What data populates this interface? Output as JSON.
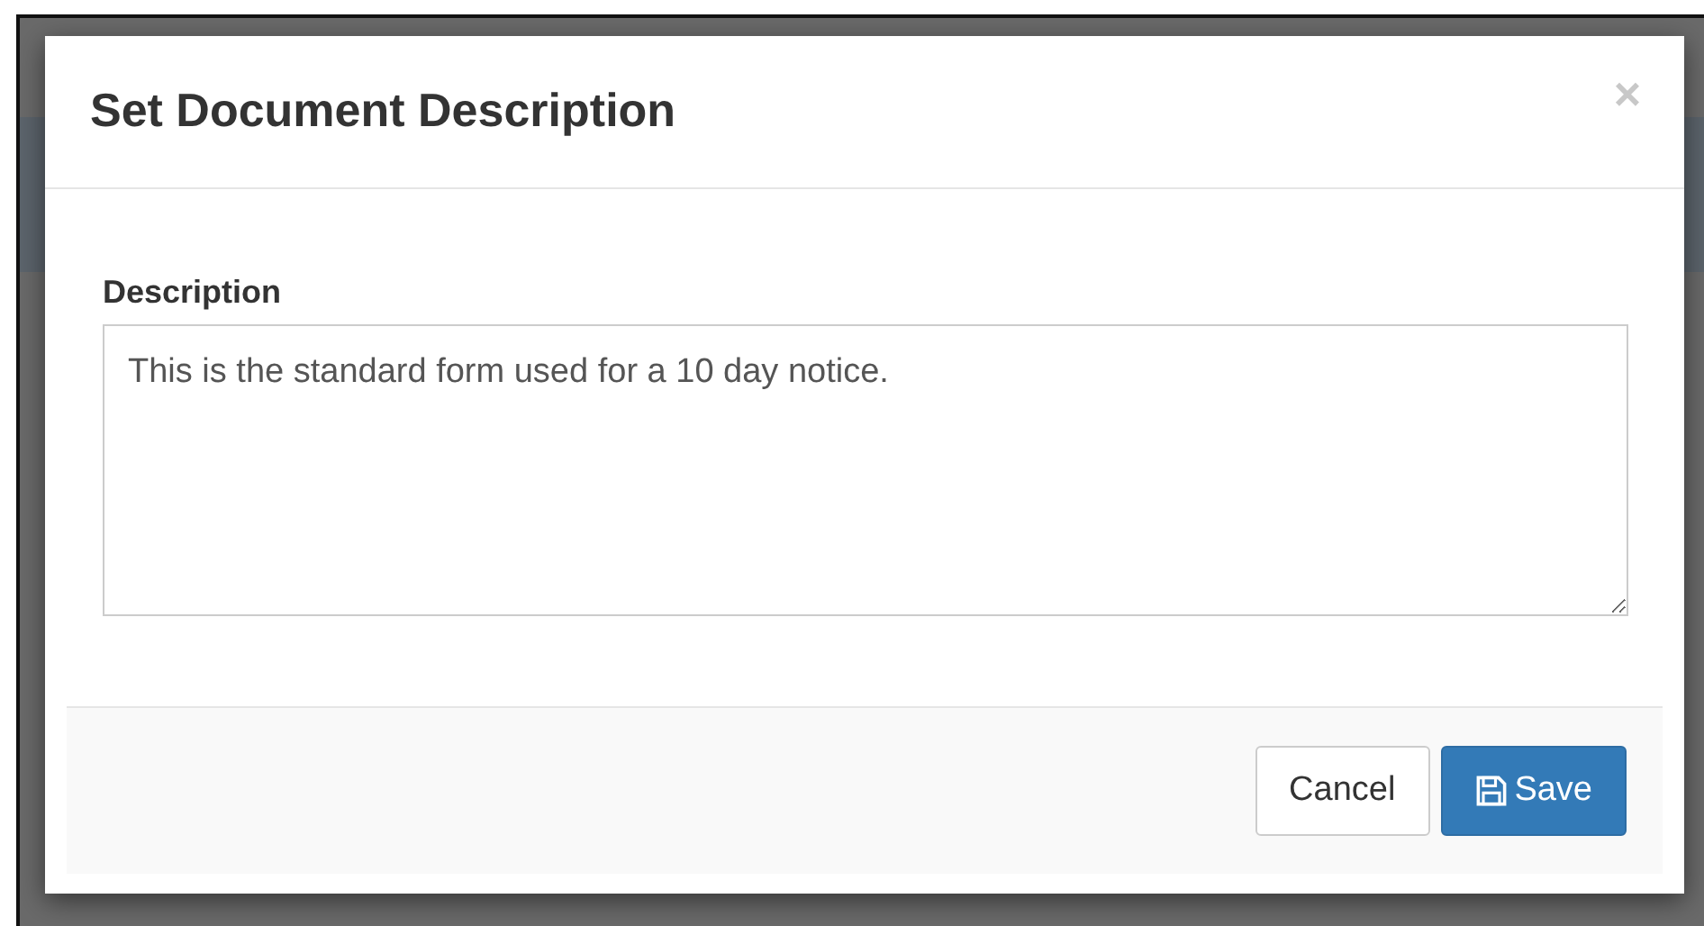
{
  "dialog": {
    "title": "Set Document Description",
    "close": "×"
  },
  "field": {
    "label": "Description",
    "value": "This is the standard form used for a 10 day notice."
  },
  "buttons": [
    {
      "label": "Cancel",
      "kind": "default"
    },
    {
      "label": "Save",
      "kind": "primary"
    }
  ]
}
